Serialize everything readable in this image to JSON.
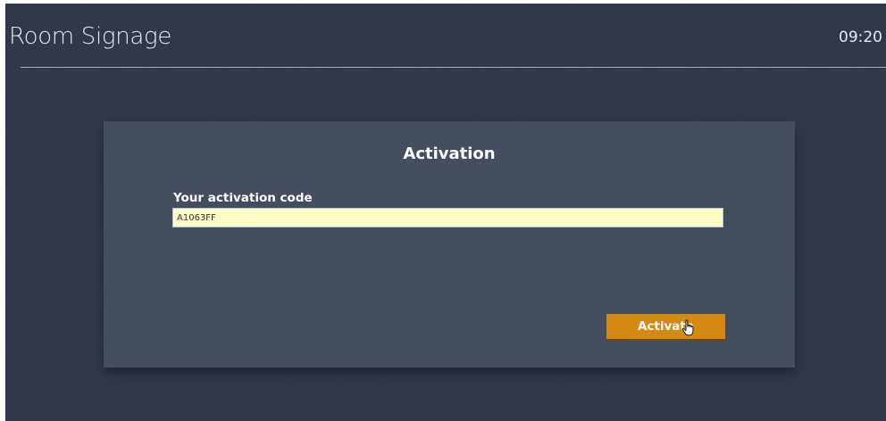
{
  "header": {
    "title": "Room Signage",
    "time": "09:20"
  },
  "activation": {
    "title": "Activation",
    "code_label": "Your activation code",
    "code_value": "A1063FF",
    "submit_label": "Activate"
  },
  "colors": {
    "background": "#2f3748",
    "panel": "#454e5e",
    "input_background": "#fdfdc8",
    "button": "#d48a12"
  },
  "icons": {
    "cursor": "hand-pointer-icon"
  }
}
